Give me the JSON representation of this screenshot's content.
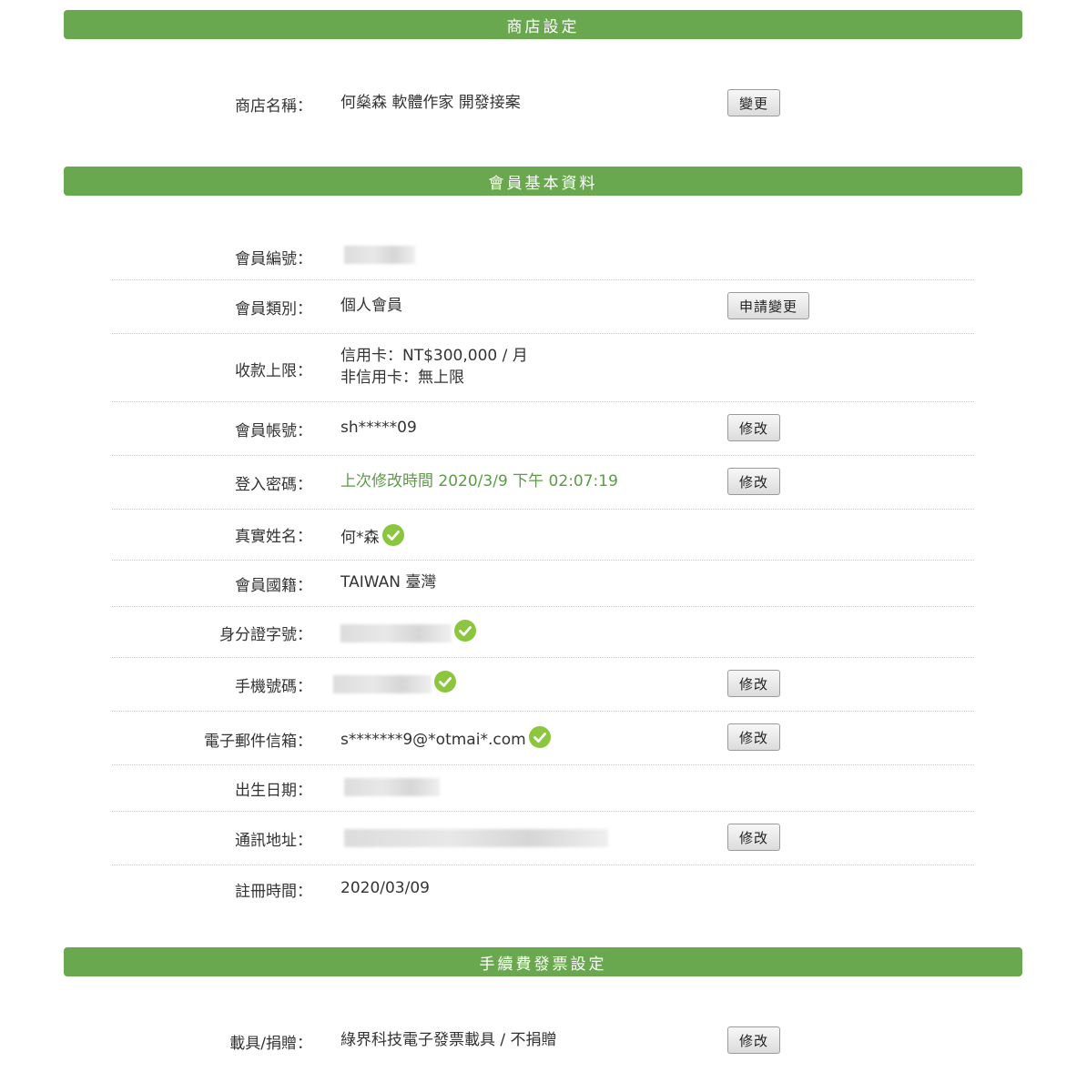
{
  "sections": {
    "store": "商店設定",
    "member": "會員基本資料",
    "fee_invoice": "手續費發票設定"
  },
  "store": {
    "name_label": "商店名稱：",
    "name_value": "何燊森 軟體作家 開發接案",
    "change_button": "變更"
  },
  "member": {
    "id_label": "會員編號：",
    "type_label": "會員類別：",
    "type_value": "個人會員",
    "type_button": "申請變更",
    "limit_label": "收款上限：",
    "limit_credit": "信用卡：NT$300,000 / 月",
    "limit_noncredit": "非信用卡：無上限",
    "account_label": "會員帳號：",
    "account_value": "sh*****09",
    "password_label": "登入密碼：",
    "password_value": "上次修改時間 2020/3/9 下午 02:07:19",
    "realname_label": "真實姓名：",
    "realname_value": "何*森",
    "nationality_label": "會員國籍：",
    "nationality_value": "TAIWAN 臺灣",
    "idnum_label": "身分證字號：",
    "mobile_label": "手機號碼：",
    "email_label": "電子郵件信箱：",
    "email_value": "s*******9@*otmai*.com",
    "birthday_label": "出生日期：",
    "address_label": "通訊地址：",
    "registered_label": "註冊時間：",
    "registered_value": "2020/03/09",
    "edit_button": "修改"
  },
  "fee_invoice": {
    "carrier_label": "載具/捐贈：",
    "carrier_value": "綠界科技電子發票載具 / 不捐贈",
    "edit_button": "修改"
  },
  "colors": {
    "section_bar": "#6aa84f",
    "verified_check": "#8cc63f",
    "password_text": "#5e9a47"
  }
}
